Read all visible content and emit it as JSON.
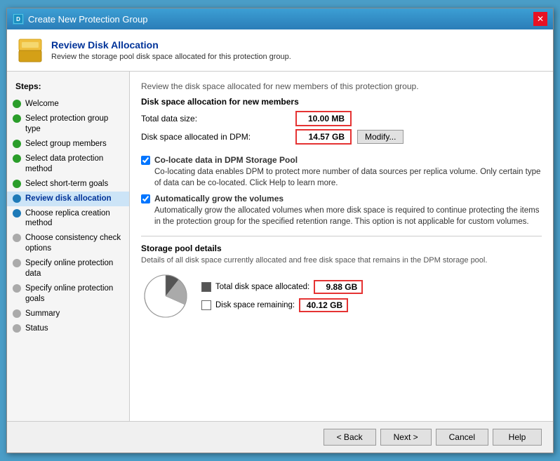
{
  "window": {
    "title": "Create New Protection Group",
    "icon_label": "DPM"
  },
  "header": {
    "title": "Review Disk Allocation",
    "description": "Review the storage pool disk space allocated for this protection group."
  },
  "sidebar": {
    "steps_label": "Steps:",
    "items": [
      {
        "id": "welcome",
        "label": "Welcome",
        "status": "green",
        "active": false
      },
      {
        "id": "select-group-type",
        "label": "Select protection group type",
        "status": "green",
        "active": false
      },
      {
        "id": "select-members",
        "label": "Select group members",
        "status": "green",
        "active": false
      },
      {
        "id": "select-data-protection",
        "label": "Select data protection method",
        "status": "green",
        "active": false
      },
      {
        "id": "select-short-term",
        "label": "Select short-term goals",
        "status": "green",
        "active": false
      },
      {
        "id": "review-disk",
        "label": "Review disk allocation",
        "status": "blue",
        "active": true
      },
      {
        "id": "choose-replica",
        "label": "Choose replica creation method",
        "status": "blue",
        "active": false
      },
      {
        "id": "choose-consistency",
        "label": "Choose consistency check options",
        "status": "gray",
        "active": false
      },
      {
        "id": "specify-online",
        "label": "Specify online protection data",
        "status": "gray",
        "active": false
      },
      {
        "id": "specify-online-goals",
        "label": "Specify online protection goals",
        "status": "gray",
        "active": false
      },
      {
        "id": "summary",
        "label": "Summary",
        "status": "gray",
        "active": false
      },
      {
        "id": "status",
        "label": "Status",
        "status": "gray",
        "active": false
      }
    ]
  },
  "main": {
    "section_intro": "Review the disk space allocated for new members of this protection group.",
    "allocation_section_title": "Disk space allocation for new members",
    "total_data_label": "Total data size:",
    "total_data_value": "10.00 MB",
    "disk_space_label": "Disk space allocated in DPM:",
    "disk_space_value": "14.57 GB",
    "modify_label": "Modify...",
    "colocate_label": "Co-locate data in DPM Storage Pool",
    "colocate_desc": "Co-locating data enables DPM to protect more number of data sources per replica volume. Only certain type of data can be co-located. Click Help to learn more.",
    "autogrow_label": "Automatically grow the volumes",
    "autogrow_desc": "Automatically grow the allocated volumes when more disk space is required to continue protecting the items in the protection group for the specified retention range. This option is not applicable for custom volumes.",
    "storage_pool_title": "Storage pool details",
    "storage_pool_desc": "Details of all disk space currently allocated and free disk space that remains in the DPM storage pool.",
    "total_allocated_label": "Total disk space allocated:",
    "total_allocated_value": "9.88 GB",
    "disk_remaining_label": "Disk space remaining:",
    "disk_remaining_value": "40.12 GB"
  },
  "footer": {
    "back_label": "< Back",
    "next_label": "Next >",
    "cancel_label": "Cancel",
    "help_label": "Help"
  }
}
